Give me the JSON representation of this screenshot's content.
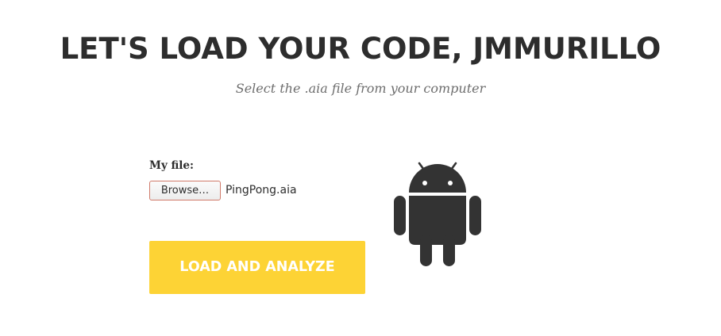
{
  "header": {
    "title": "LET'S LOAD YOUR CODE, JMMURILLO",
    "subtitle": "Select the .aia file from your computer"
  },
  "upload_form": {
    "file_label": "My file:",
    "browse_label": "Browse…",
    "selected_file": "PingPong.aia",
    "submit_label": "LOAD AND ANALYZE"
  },
  "decoration": {
    "logo_icon": "android-robot-icon"
  },
  "colors": {
    "title_text": "#2d2d2d",
    "subtitle_text": "#6d6d6d",
    "accent_button": "#fdd335",
    "button_text": "#ffffff",
    "logo_fill": "#333333",
    "background": "#ffffff"
  }
}
